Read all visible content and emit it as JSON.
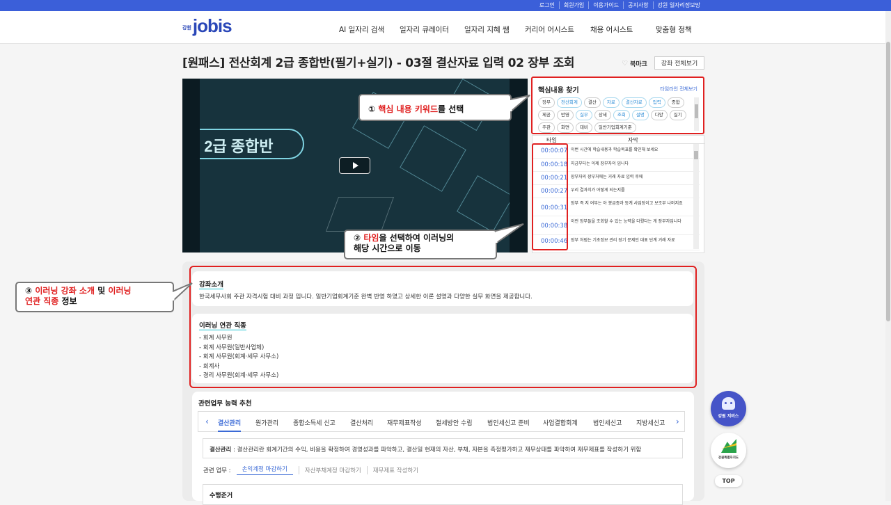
{
  "util_links": [
    "로그인",
    "회원가입",
    "이용가이드",
    "공지사항",
    "강원 일자리정보망"
  ],
  "logo": {
    "sub": "강원",
    "main": "jobis"
  },
  "gnb": [
    "AI 일자리 검색",
    "일자리 큐레이터",
    "일자리 지혜 쌤",
    "커리어 어시스트",
    "채용 어시스트",
    "맞춤형 정책"
  ],
  "page_title": "[원패스] 전산회계 2급 종합반(필기+실기) - 03절 결산자료 입력 02 장부 조회",
  "bookmark_label": "북마크",
  "all_lectures_label": "강좌 전체보기",
  "video": {
    "overlay_text": "l 2급 종합반"
  },
  "keywords": {
    "title": "핵심내용 찾기",
    "timeline_link": "타임라인 전체보기",
    "chips": [
      {
        "label": "장부",
        "hl": false
      },
      {
        "label": "전산회계",
        "hl": true
      },
      {
        "label": "결산",
        "hl": false
      },
      {
        "label": "자료",
        "hl": true
      },
      {
        "label": "결산자료",
        "hl": true
      },
      {
        "label": "입력",
        "hl": true
      },
      {
        "label": "종합",
        "hl": false
      },
      {
        "label": "제공",
        "hl": false
      },
      {
        "label": "반영",
        "hl": false
      },
      {
        "label": "실무",
        "hl": true
      },
      {
        "label": "상세",
        "hl": false
      },
      {
        "label": "조회",
        "hl": true
      },
      {
        "label": "설명",
        "hl": true
      },
      {
        "label": "다양",
        "hl": false
      },
      {
        "label": "실기",
        "hl": false
      },
      {
        "label": "주관",
        "hl": false
      },
      {
        "label": "화면",
        "hl": false
      },
      {
        "label": "대비",
        "hl": false
      },
      {
        "label": "일반기업회계기준",
        "hl": false
      }
    ]
  },
  "subtitles": {
    "col_time": "타임",
    "col_text": "자막",
    "rows": [
      {
        "time": "00:00:07",
        "text": "이번 시간에 학습내용과 학습목표를 확인해 보세요"
      },
      {
        "time": "00:00:18",
        "text": "지금부터는 이제 장부자의 입니다"
      },
      {
        "time": "00:00:21",
        "text": "장부자의 장부처에는 거래 자료 입력 후에"
      },
      {
        "time": "00:00:27",
        "text": "우리 결과치가 어떻게 되는지를"
      },
      {
        "time": "00:00:31",
        "text": "장부 즉 지 여부는 아 봉급증과 등계 사업장이고 보조부 나머지죠"
      },
      {
        "time": "00:00:38",
        "text": "이런 장부들을 조회할 수 있는 능력을 다뤘다는 게 장부자입니다"
      },
      {
        "time": "00:00:46",
        "text": "장부 처럼는 기초정보 관리 장기 문제인 대표 단계 거래 자료"
      }
    ]
  },
  "callouts": {
    "c1": {
      "num": "①",
      "red": "핵심 내용 키워드",
      "rest": "를 선택"
    },
    "c2": {
      "num": "②",
      "red": "타임",
      "rest1": "을 선택하여 이러닝의",
      "rest2": "해당 시간으로 이동"
    },
    "c3": {
      "num": "③",
      "red1": "이러닝 강좌 소개",
      "mid": " 및 ",
      "red2": "이러닝",
      "red3": "연관 직종",
      "rest": " 정보"
    }
  },
  "course_intro": {
    "title": "강좌소개",
    "text": "한국세무사회 주관 자격시험 대비 과정 입니다. 일반기업회계기준 완벽 반영 하였고 상세한 이론 설명과 다양한 실무 화면을 제공합니다."
  },
  "related_jobs": {
    "title": "이러닝 연관 직종",
    "items": [
      "- 회계 사무원",
      "- 회계 사무원(일반사업체)",
      "- 회계 사무원(회계·세무 사무소)",
      "- 회계사",
      "- 경리 사무원(회계·세무 사무소)"
    ]
  },
  "competency": {
    "title": "관련업무 능력 추천",
    "tabs": [
      "결산관리",
      "원가관리",
      "종합소득세 신고",
      "결산처리",
      "재무제표작성",
      "절세방안 수립",
      "법인세신고 준비",
      "사업결합회계",
      "법인세신고",
      "지방세신고"
    ],
    "definition_label": "결산관리",
    "definition_text": " : 결산관리란 회계기간의 수익, 비용을 확정하여 경영성과를 파악하고, 결산일 현재의 자산, 부채, 자본을 측정평가하고 재무상태를 파악하여 재무제표를 작성하기 위함",
    "duty_label": "관련 업무 :",
    "duties": [
      "손익계정 마감하기",
      "자산부채계정 마감하기",
      "재무제표 작성하기"
    ],
    "perf_label": "수행준거"
  },
  "fab": {
    "bot": "강원 지버스",
    "gov": "강원특별자치도"
  },
  "top_label": "TOP",
  "colors": {
    "accent": "#3b5fd9",
    "highlight_red": "#e02020",
    "link_blue": "#3b6ad6"
  }
}
